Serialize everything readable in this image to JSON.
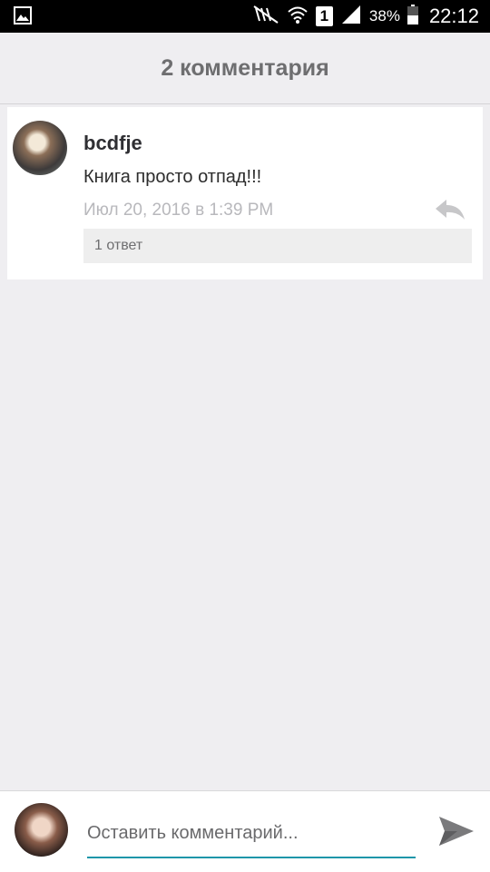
{
  "status_bar": {
    "battery_percent": "38%",
    "time": "22:12",
    "sim_label": "1",
    "icons": [
      "gallery-icon",
      "mute-icon",
      "wifi-icon",
      "sim-icon",
      "signal-icon",
      "battery-icon"
    ]
  },
  "header": {
    "title": "2 комментария"
  },
  "comments": [
    {
      "author": "bcdfje",
      "text": "Книга просто отпад!!!",
      "date": "Июл 20, 2016 в 1:39 PM",
      "replies_label": "1 ответ"
    }
  ],
  "composer": {
    "placeholder": "Оставить комментарий...",
    "value": ""
  },
  "colors": {
    "accent": "#1e96a9",
    "background": "#efeef1",
    "card": "#ffffff",
    "status_bar": "#000000"
  }
}
